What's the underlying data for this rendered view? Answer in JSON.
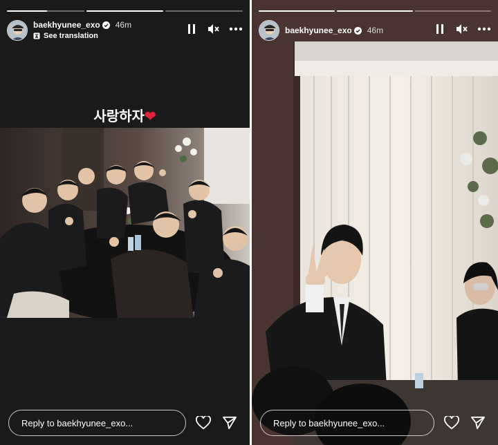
{
  "stories": [
    {
      "username": "baekhyunee_exo",
      "time": "46m",
      "see_translation": "See translation",
      "caption_text": "사랑하자",
      "caption_emoji": "❤️",
      "reply_placeholder": "Reply to baekhyunee_exo...",
      "progress": [
        0.52,
        1.0,
        0.0
      ],
      "icons": [
        "pause-icon",
        "mute-icon",
        "more-icon",
        "heart-icon",
        "send-icon",
        "translate-icon",
        "verified-icon"
      ]
    },
    {
      "username": "baekhyunee_exo",
      "time": "46m",
      "reply_placeholder": "Reply to baekhyunee_exo...",
      "progress": [
        1.0,
        1.0,
        0.0
      ],
      "icons": [
        "pause-icon",
        "mute-icon",
        "more-icon",
        "heart-icon",
        "send-icon",
        "verified-icon"
      ]
    }
  ],
  "colors": {
    "accent_heart": "#e0243b",
    "verified": "#3897f0",
    "background": "#1a1a1a"
  }
}
